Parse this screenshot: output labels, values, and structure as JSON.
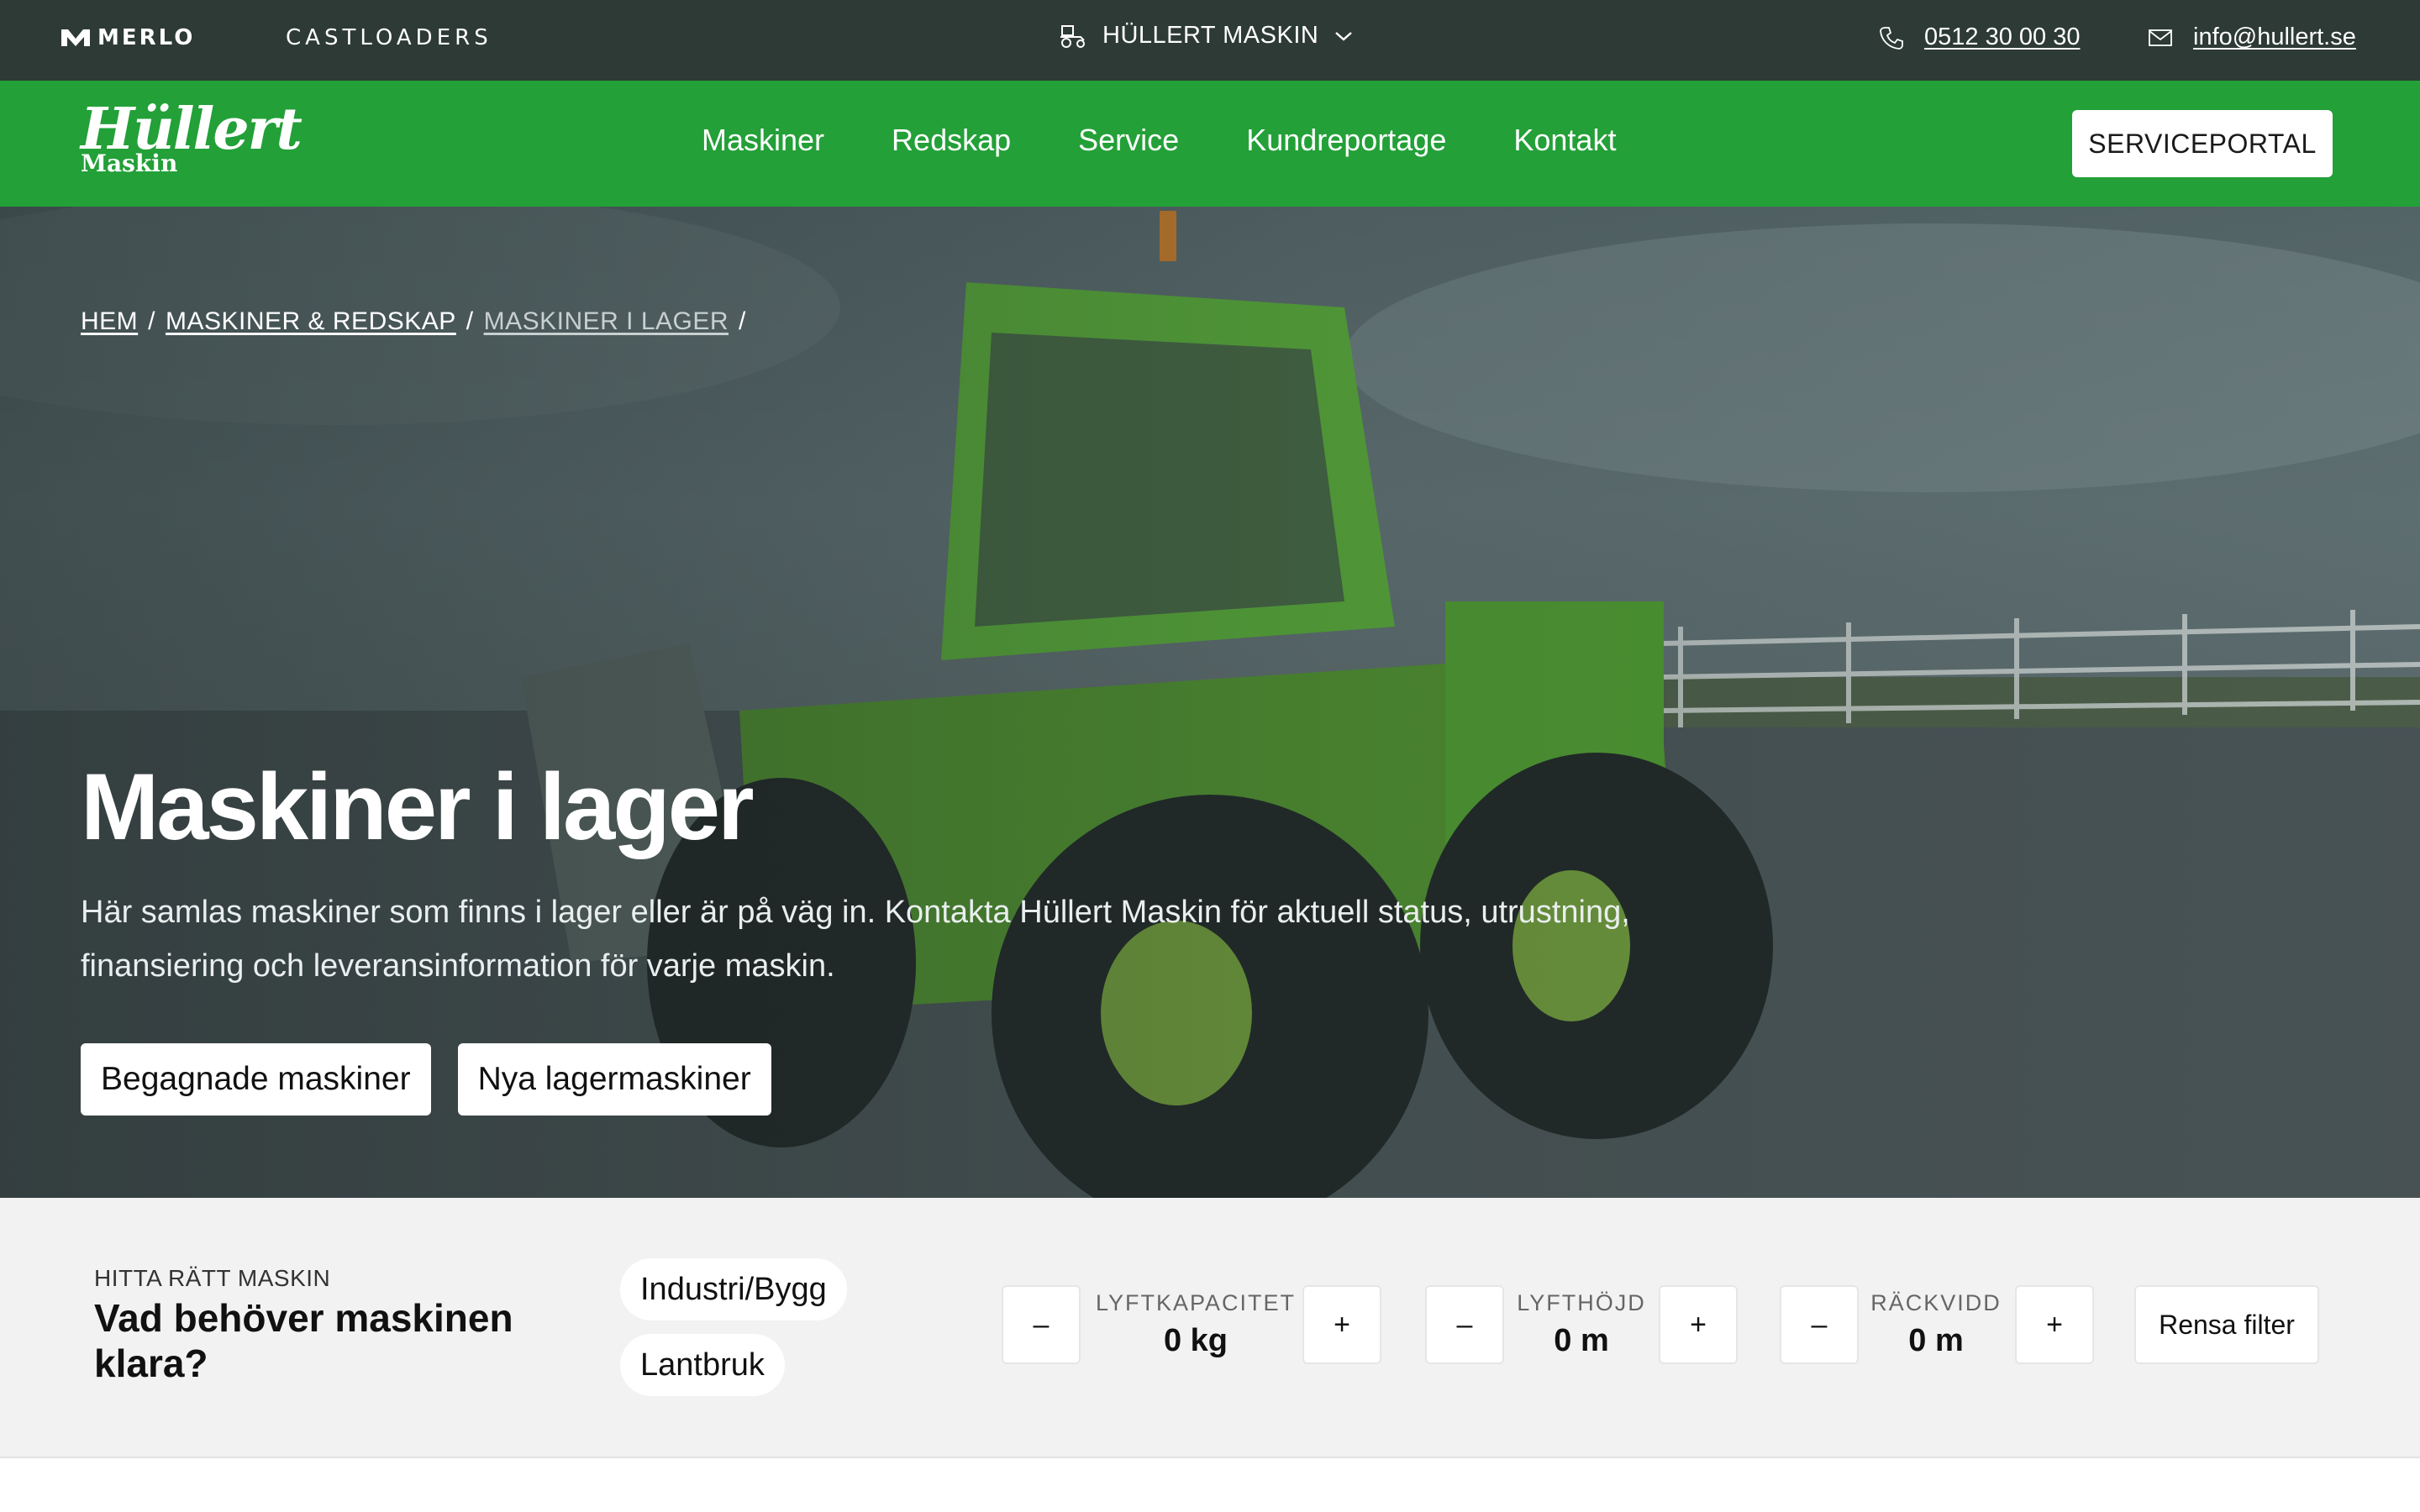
{
  "topbar": {
    "brand_1": "MERLO",
    "brand_2": "CASTLOADERS",
    "site_switch": "HÜLLERT MASKIN",
    "phone": "0512 30 00 30",
    "email": "info@hullert.se"
  },
  "nav": {
    "logo_script": "Hüllert",
    "logo_sub": "Maskin",
    "links": [
      "Maskiner",
      "Redskap",
      "Service",
      "Kundreportage",
      "Kontakt"
    ],
    "portal": "SERVICEPORTAL"
  },
  "hero": {
    "breadcrumb": [
      "HEM",
      "MASKINER & REDSKAP",
      "MASKINER I LAGER"
    ],
    "title": "Maskiner i lager",
    "lead": "Här samlas maskiner som finns i lager eller är på väg in. Kontakta Hüllert Maskin för aktuell status, utrustning, finansiering och leveransinformation för varje maskin.",
    "buttons": [
      "Begagnade maskiner",
      "Nya lagermaskiner"
    ]
  },
  "filter": {
    "eyebrow": "HITTA RÄTT MASKIN",
    "heading": "Vad behöver maskinen klara?",
    "chips": [
      "Industri/Bygg",
      "Lantbruk"
    ],
    "steppers": [
      {
        "label": "LYFTKAPACITET",
        "value": "0 kg"
      },
      {
        "label": "LYFTHÖJD",
        "value": "0 m"
      },
      {
        "label": "RÄCKVIDD",
        "value": "0 m"
      }
    ],
    "minus": "–",
    "plus": "+",
    "reset": "Rensa filter"
  },
  "icons": {
    "site_switch": "tractor-icon",
    "chevron": "chevron-down-icon",
    "phone": "phone-icon",
    "email": "mail-icon"
  },
  "colors": {
    "topbar": "#2d3a36",
    "nav": "#23a038",
    "filter_bg": "#f2f2f2"
  }
}
